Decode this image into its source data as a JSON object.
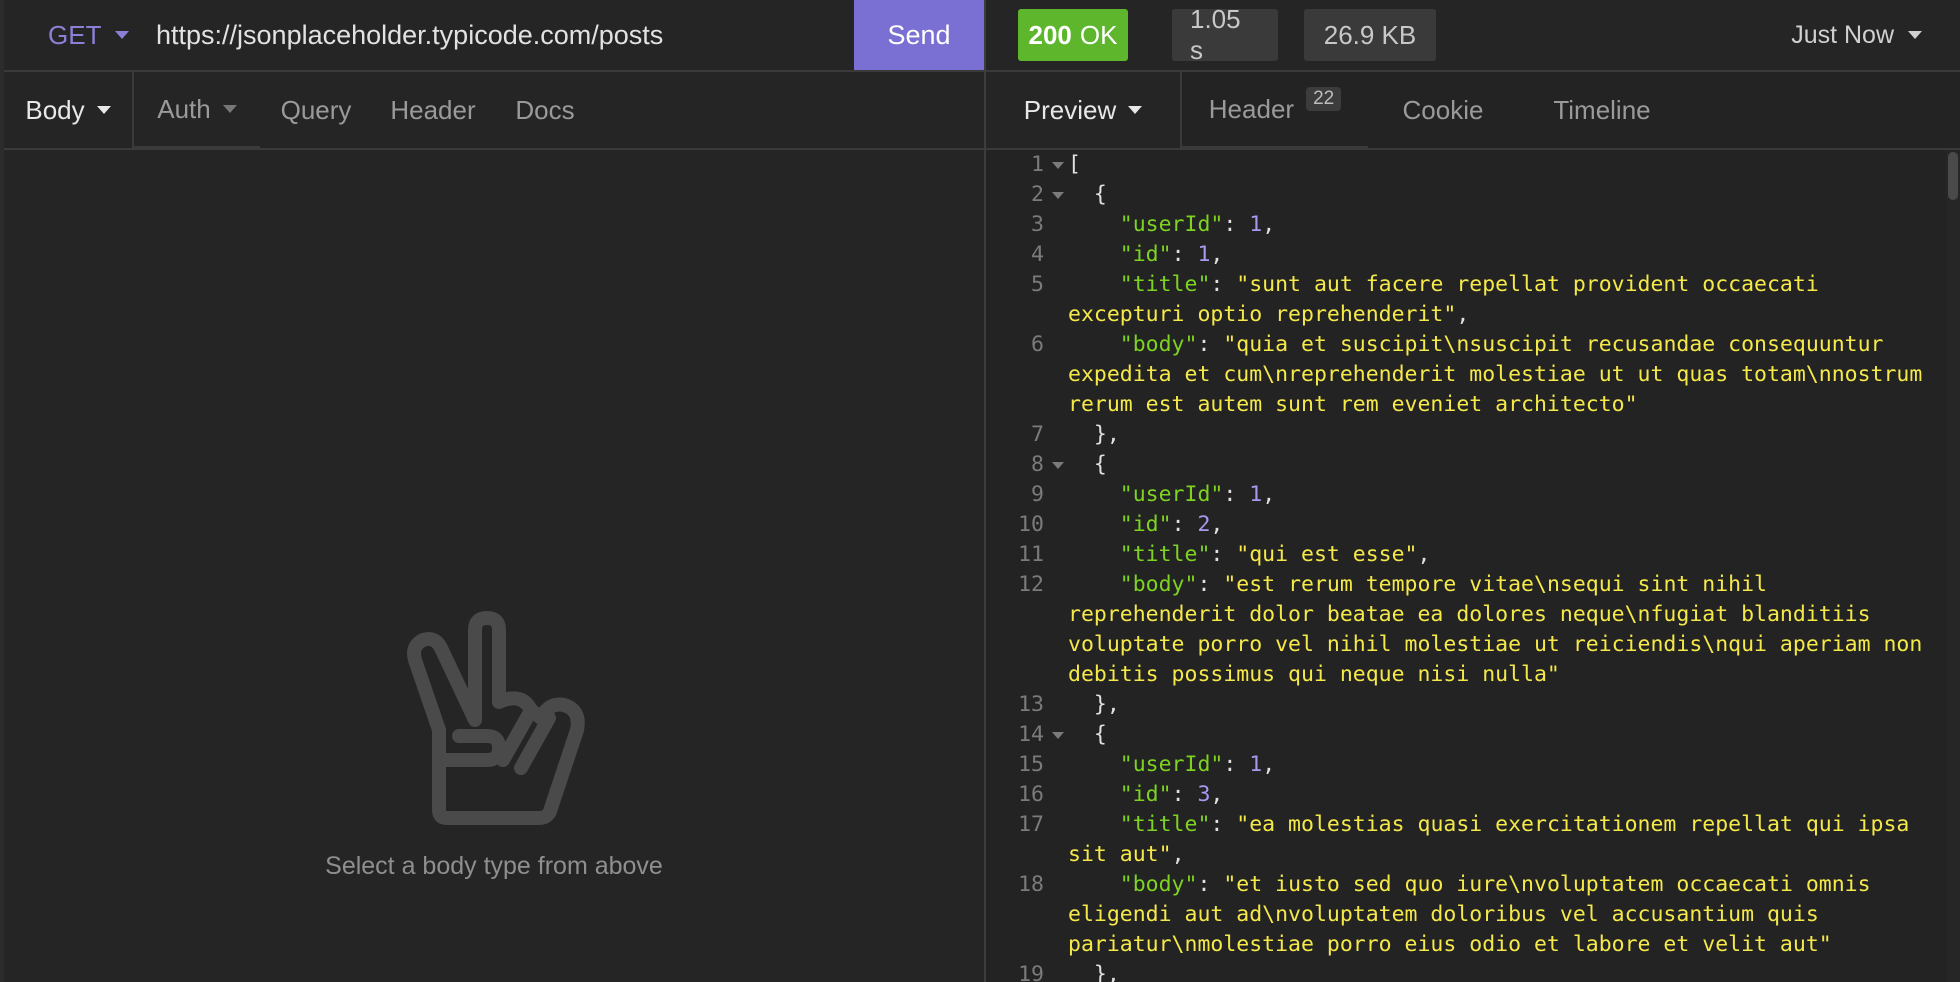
{
  "request": {
    "method": "GET",
    "url": "https://jsonplaceholder.typicode.com/posts",
    "send_label": "Send",
    "tabs": [
      {
        "label": "Body",
        "active": true,
        "dropdown": true
      },
      {
        "label": "Auth",
        "active": false,
        "dropdown": true
      },
      {
        "label": "Query",
        "active": false
      },
      {
        "label": "Header",
        "active": false
      },
      {
        "label": "Docs",
        "active": false
      }
    ],
    "empty_state": {
      "icon": "peace-hand-icon",
      "text": "Select a body type from above"
    }
  },
  "response": {
    "status_code": "200",
    "status_text": "OK",
    "status_color": "#5eb62d",
    "time": "1.05 s",
    "size": "26.9 KB",
    "history_label": "Just Now",
    "tabs": [
      {
        "label": "Preview",
        "active": true,
        "dropdown": true
      },
      {
        "label": "Header",
        "count": "22"
      },
      {
        "label": "Cookie"
      },
      {
        "label": "Timeline"
      }
    ],
    "lines": [
      {
        "n": "1",
        "fold": true,
        "html": "["
      },
      {
        "n": "2",
        "fold": true,
        "html": "  {"
      },
      {
        "n": "3",
        "html": "    <span class=\"k\">\"userId\"</span>: <span class=\"n\">1</span>,"
      },
      {
        "n": "4",
        "html": "    <span class=\"k\">\"id\"</span>: <span class=\"n\">1</span>,"
      },
      {
        "n": "5",
        "html": "    <span class=\"k\">\"title\"</span>: <span class=\"s\">\"sunt aut facere repellat provident occaecati excepturi optio reprehenderit\"</span>,"
      },
      {
        "n": "6",
        "html": "    <span class=\"k\">\"body\"</span>: <span class=\"s\">\"quia et suscipit\\nsuscipit recusandae consequuntur expedita et cum\\nreprehenderit molestiae ut ut quas totam\\nnostrum rerum est autem sunt rem eveniet architecto\"</span>"
      },
      {
        "n": "7",
        "html": "  },"
      },
      {
        "n": "8",
        "fold": true,
        "html": "  {"
      },
      {
        "n": "9",
        "html": "    <span class=\"k\">\"userId\"</span>: <span class=\"n\">1</span>,"
      },
      {
        "n": "10",
        "html": "    <span class=\"k\">\"id\"</span>: <span class=\"n\">2</span>,"
      },
      {
        "n": "11",
        "html": "    <span class=\"k\">\"title\"</span>: <span class=\"s\">\"qui est esse\"</span>,"
      },
      {
        "n": "12",
        "html": "    <span class=\"k\">\"body\"</span>: <span class=\"s\">\"est rerum tempore vitae\\nsequi sint nihil reprehenderit dolor beatae ea dolores neque\\nfugiat blanditiis voluptate porro vel nihil molestiae ut reiciendis\\nqui aperiam non debitis possimus qui neque nisi nulla\"</span>"
      },
      {
        "n": "13",
        "html": "  },"
      },
      {
        "n": "14",
        "fold": true,
        "html": "  {"
      },
      {
        "n": "15",
        "html": "    <span class=\"k\">\"userId\"</span>: <span class=\"n\">1</span>,"
      },
      {
        "n": "16",
        "html": "    <span class=\"k\">\"id\"</span>: <span class=\"n\">3</span>,"
      },
      {
        "n": "17",
        "html": "    <span class=\"k\">\"title\"</span>: <span class=\"s\">\"ea molestias quasi exercitationem repellat qui ipsa sit aut\"</span>,"
      },
      {
        "n": "18",
        "html": "    <span class=\"k\">\"body\"</span>: <span class=\"s\">\"et iusto sed quo iure\\nvoluptatem occaecati omnis eligendi aut ad\\nvoluptatem doloribus vel accusantium quis pariatur\\nmolestiae porro eius odio et labore et velit aut\"</span>"
      },
      {
        "n": "19",
        "html": "  },"
      }
    ]
  }
}
